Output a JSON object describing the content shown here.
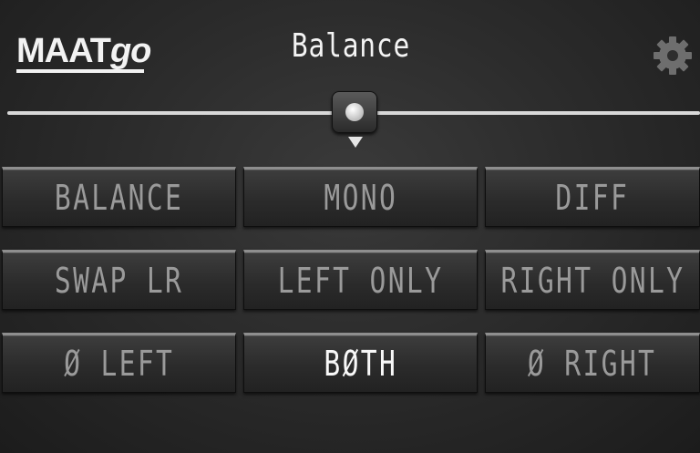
{
  "app": {
    "logo_main": "MAAT",
    "logo_suffix": "go",
    "title": "Balance"
  },
  "slider": {
    "value": 0.5
  },
  "buttons": [
    {
      "label": "BALANCE"
    },
    {
      "label": "MONO"
    },
    {
      "label": "DIFF"
    },
    {
      "label": "SWAP LR"
    },
    {
      "label": "LEFT ONLY"
    },
    {
      "label": "RIGHT ONLY"
    },
    {
      "label": "Ø LEFT"
    },
    {
      "label": "BØTH",
      "active": true
    },
    {
      "label": "Ø RIGHT"
    }
  ],
  "colors": {
    "inactive_text": "#9a9a9a",
    "active_text": "#f8f8f8",
    "background": "#2c2c2c"
  },
  "icons": {
    "settings": "gear-icon"
  }
}
